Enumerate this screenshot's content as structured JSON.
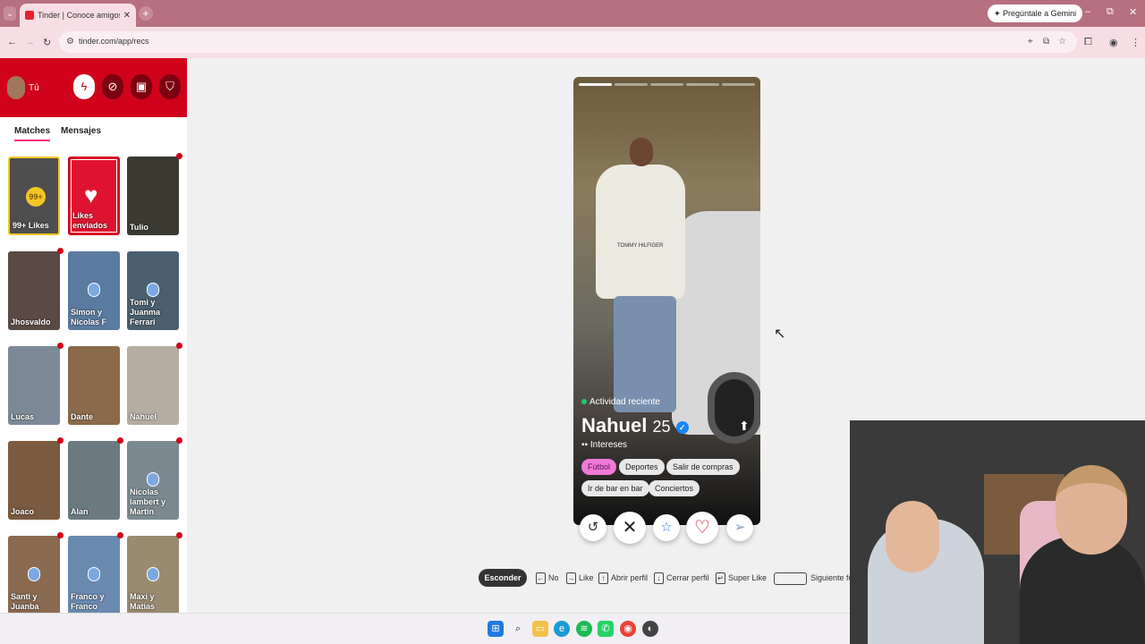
{
  "browser": {
    "tab_title": "Tinder | Conoce amigos y gente",
    "tab_close": "✕",
    "tab_menu": "⌄",
    "new_tab": "+",
    "gemini": "Pregúntale a Gemini",
    "url": "tinder.com/app/recs",
    "win_minimize": "–",
    "win_restore": "⧉",
    "win_close": "✕",
    "nav_back": "←",
    "nav_forward": "→",
    "nav_reload": "↻"
  },
  "sidebar": {
    "user_label": "Tú",
    "tabs": [
      "Matches",
      "Mensajes"
    ],
    "likes_count": "99+",
    "likes_label": "99+ Likes",
    "sent_label": "Likes enviados",
    "matches": [
      {
        "name": "Tulio",
        "color": "#3a3a30"
      },
      {
        "name": "Jhosvaldo",
        "color": "#5a4a44"
      },
      {
        "name": "Simon y Nicolas F",
        "color": "#5a7aa0"
      },
      {
        "name": "Tomi y Juanma Ferrari",
        "color": "#4a6070"
      },
      {
        "name": "Lucas",
        "color": "#7c8a98"
      },
      {
        "name": "Dante",
        "color": "#8a6a4a"
      },
      {
        "name": "Nahuel",
        "color": "#b5aca2"
      },
      {
        "name": "Joaco",
        "color": "#7a5a40"
      },
      {
        "name": "Alan",
        "color": "#6a7a80"
      },
      {
        "name": "Nicolas lambert y Martin",
        "color": "#7a8a90"
      },
      {
        "name": "Santi y Juanba",
        "color": "#8a6a50"
      },
      {
        "name": "Franco y Franco",
        "color": "#6a8ab0"
      },
      {
        "name": "Maxi y Matias",
        "color": "#9a8a70"
      }
    ]
  },
  "profile": {
    "activity": "Actividad reciente",
    "name": "Nahuel",
    "age": "25",
    "interests_label": "Intereses",
    "chips": [
      "Fútbol",
      "Deportes",
      "Salir de compras",
      "Ir de bar en bar",
      "Conciertos"
    ],
    "hoodie_text": "TOMMY HILFIGER",
    "photo_count": 5,
    "photo_current": 1
  },
  "actions": {
    "rewind": "↺",
    "nope": "✕",
    "superlike": "☆",
    "like": "♡",
    "boost": "➢"
  },
  "shortcuts": {
    "hide": "Esconder",
    "no": "No",
    "like": "Like",
    "open": "Abrir perfil",
    "close": "Cerrar perfil",
    "superlike": "Super Like",
    "next": "Siguiente fo"
  },
  "colors": {
    "tinder_red": "#d0021b",
    "brand_pink": "#fd267a",
    "likes_gold": "#f3c624"
  }
}
